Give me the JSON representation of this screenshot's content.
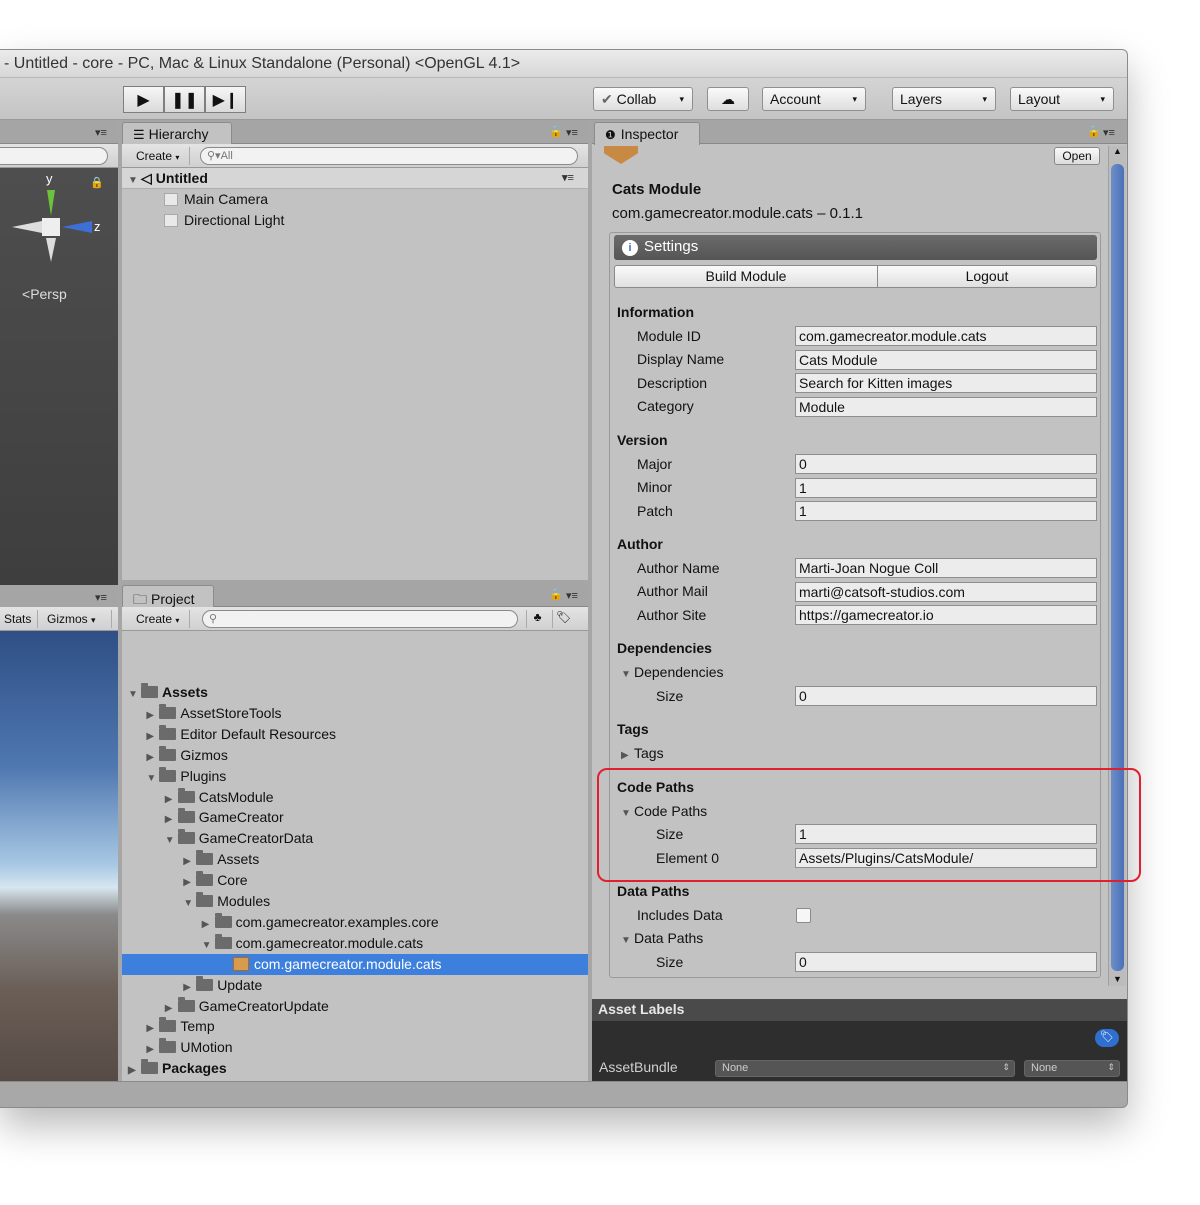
{
  "window": {
    "title": "- Untitled - core - PC, Mac & Linux Standalone (Personal) <OpenGL 4.1>"
  },
  "toolbar": {
    "play_icon": "play-icon",
    "pause_icon": "pause-icon",
    "step_icon": "step-icon",
    "collab_label": "Collab",
    "cloud_icon": "cloud-icon",
    "account_label": "Account",
    "layers_label": "Layers",
    "layout_label": "Layout",
    "dropdown_glyph": "▾"
  },
  "scene": {
    "gizmo_y": "y",
    "gizmo_z": "z",
    "persp_label": "Persp"
  },
  "game": {
    "stats_label": "Stats",
    "gizmos_label": "Gizmos"
  },
  "hierarchy": {
    "tab_label": "Hierarchy",
    "create_label": "Create",
    "search_placeholder": "All",
    "scene_name": "Untitled",
    "items": [
      "Main Camera",
      "Directional Light"
    ]
  },
  "project": {
    "tab_label": "Project",
    "create_label": "Create",
    "tree": [
      {
        "label": "Assets",
        "depth": 0,
        "arrow": "open",
        "bold": true
      },
      {
        "label": "AssetStoreTools",
        "depth": 1,
        "arrow": "closed"
      },
      {
        "label": "Editor Default Resources",
        "depth": 1,
        "arrow": "closed"
      },
      {
        "label": "Gizmos",
        "depth": 1,
        "arrow": "closed"
      },
      {
        "label": "Plugins",
        "depth": 1,
        "arrow": "open"
      },
      {
        "label": "CatsModule",
        "depth": 2,
        "arrow": "closed"
      },
      {
        "label": "GameCreator",
        "depth": 2,
        "arrow": "closed"
      },
      {
        "label": "GameCreatorData",
        "depth": 2,
        "arrow": "open"
      },
      {
        "label": "Assets",
        "depth": 3,
        "arrow": "closed"
      },
      {
        "label": "Core",
        "depth": 3,
        "arrow": "closed"
      },
      {
        "label": "Modules",
        "depth": 3,
        "arrow": "open"
      },
      {
        "label": "com.gamecreator.examples.core",
        "depth": 4,
        "arrow": "closed"
      },
      {
        "label": "com.gamecreator.module.cats",
        "depth": 4,
        "arrow": "open"
      },
      {
        "label": "com.gamecreator.module.cats",
        "depth": 5,
        "arrow": "none",
        "asset": true,
        "selected": true
      },
      {
        "label": "Update",
        "depth": 3,
        "arrow": "closed"
      },
      {
        "label": "GameCreatorUpdate",
        "depth": 2,
        "arrow": "closed"
      },
      {
        "label": "Temp",
        "depth": 1,
        "arrow": "closed"
      },
      {
        "label": "UMotion",
        "depth": 1,
        "arrow": "closed"
      },
      {
        "label": "Packages",
        "depth": 0,
        "arrow": "closed",
        "bold": true
      }
    ]
  },
  "inspector": {
    "tab_label": "Inspector",
    "open_label": "Open",
    "asset_title": "Cats Module",
    "asset_subtitle": "com.gamecreator.module.cats – 0.1.1",
    "settings_label": "Settings",
    "build_label": "Build Module",
    "logout_label": "Logout",
    "information": {
      "header": "Information",
      "module_id_label": "Module ID",
      "module_id": "com.gamecreator.module.cats",
      "display_name_label": "Display Name",
      "display_name": "Cats Module",
      "description_label": "Description",
      "description": "Search for Kitten images",
      "category_label": "Category",
      "category": "Module"
    },
    "version": {
      "header": "Version",
      "major_label": "Major",
      "major": "0",
      "minor_label": "Minor",
      "minor": "1",
      "patch_label": "Patch",
      "patch": "1"
    },
    "author": {
      "header": "Author",
      "name_label": "Author Name",
      "name": "Marti-Joan Nogue Coll",
      "mail_label": "Author Mail",
      "mail": "marti@catsoft-studios.com",
      "site_label": "Author Site",
      "site": "https://gamecreator.io"
    },
    "dependencies": {
      "header": "Dependencies",
      "foldout": "Dependencies",
      "size_label": "Size",
      "size": "0"
    },
    "tags": {
      "header": "Tags",
      "foldout": "Tags"
    },
    "code_paths": {
      "header": "Code Paths",
      "foldout": "Code Paths",
      "size_label": "Size",
      "size": "1",
      "element_label": "Element 0",
      "element": "Assets/Plugins/CatsModule/"
    },
    "data_paths": {
      "header": "Data Paths",
      "includes_label": "Includes Data",
      "includes": false,
      "foldout": "Data Paths",
      "size_label": "Size",
      "size": "0"
    },
    "asset_labels": "Asset Labels",
    "assetbundle_label": "AssetBundle",
    "bundle_name": "None",
    "bundle_variant": "None"
  },
  "colors": {
    "highlight": "#e02030",
    "selection": "#3d7fdd"
  }
}
